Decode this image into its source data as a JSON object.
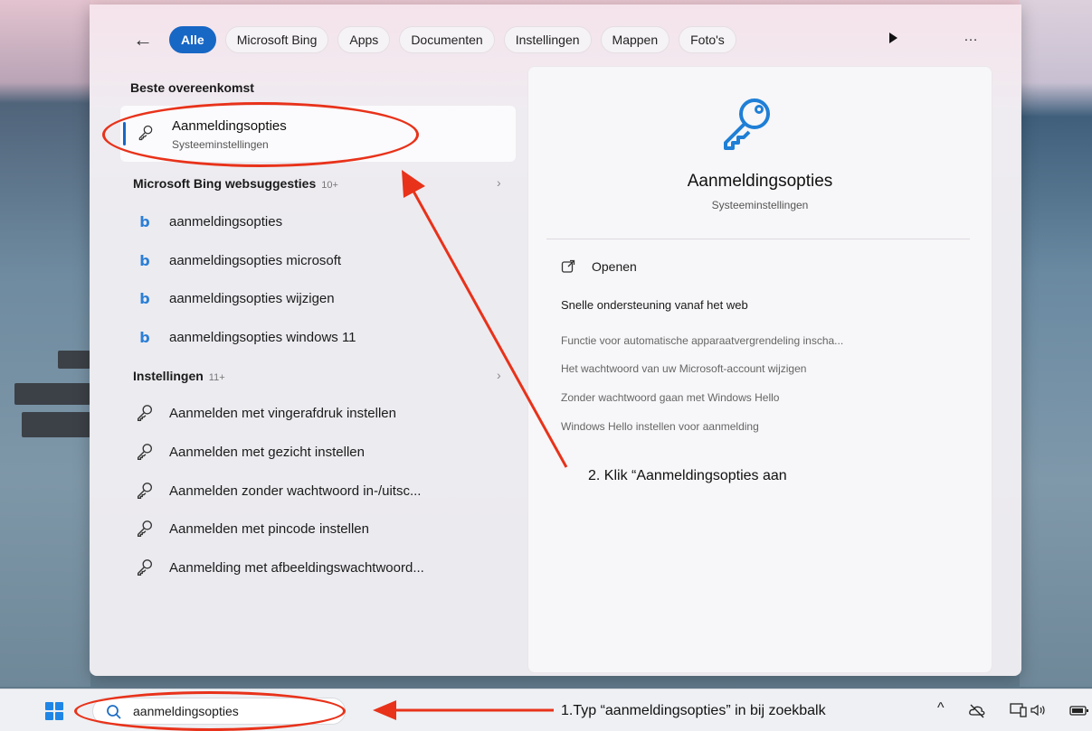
{
  "filters": {
    "back_icon": "arrow-left-icon",
    "chips": [
      "Alle",
      "Microsoft Bing",
      "Apps",
      "Documenten",
      "Instellingen",
      "Mappen",
      "Foto's"
    ],
    "active": "Alle",
    "more_label": "…"
  },
  "best_match": {
    "heading": "Beste overeenkomst",
    "title": "Aanmeldingsopties",
    "subtitle": "Systeeminstellingen",
    "icon": "key-icon"
  },
  "bing": {
    "heading": "Microsoft Bing websuggesties",
    "count": "10+",
    "items": [
      "aanmeldingsopties",
      "aanmeldingsopties microsoft",
      "aanmeldingsopties wijzigen",
      "aanmeldingsopties windows 11"
    ]
  },
  "settings": {
    "heading": "Instellingen",
    "count": "11+",
    "items": [
      "Aanmelden met vingerafdruk instellen",
      "Aanmelden met gezicht instellen",
      "Aanmelden zonder wachtwoord in-/uitsc...",
      "Aanmelden met pincode instellen",
      "Aanmelding met afbeeldingswachtwoord..."
    ]
  },
  "preview": {
    "title": "Aanmeldingsopties",
    "subtitle": "Systeeminstellingen",
    "open_label": "Openen",
    "support_heading": "Snelle ondersteuning vanaf het web",
    "links": [
      "Functie voor automatische apparaatvergrendeling inscha...",
      "Het wachtwoord van uw Microsoft-account wijzigen",
      "Zonder wachtwoord gaan met Windows Hello",
      "Windows Hello instellen voor aanmelding"
    ]
  },
  "annotations": {
    "step1": "1.Typ “aanmeldingsopties” in bij zoekbalk",
    "step2": "2. Klik “Aanmeldingsopties aan",
    "color": "#e8321a"
  },
  "taskbar": {
    "search_value": "aanmeldingsopties",
    "tray_chevron": "^",
    "accent": "#1f86e6"
  }
}
